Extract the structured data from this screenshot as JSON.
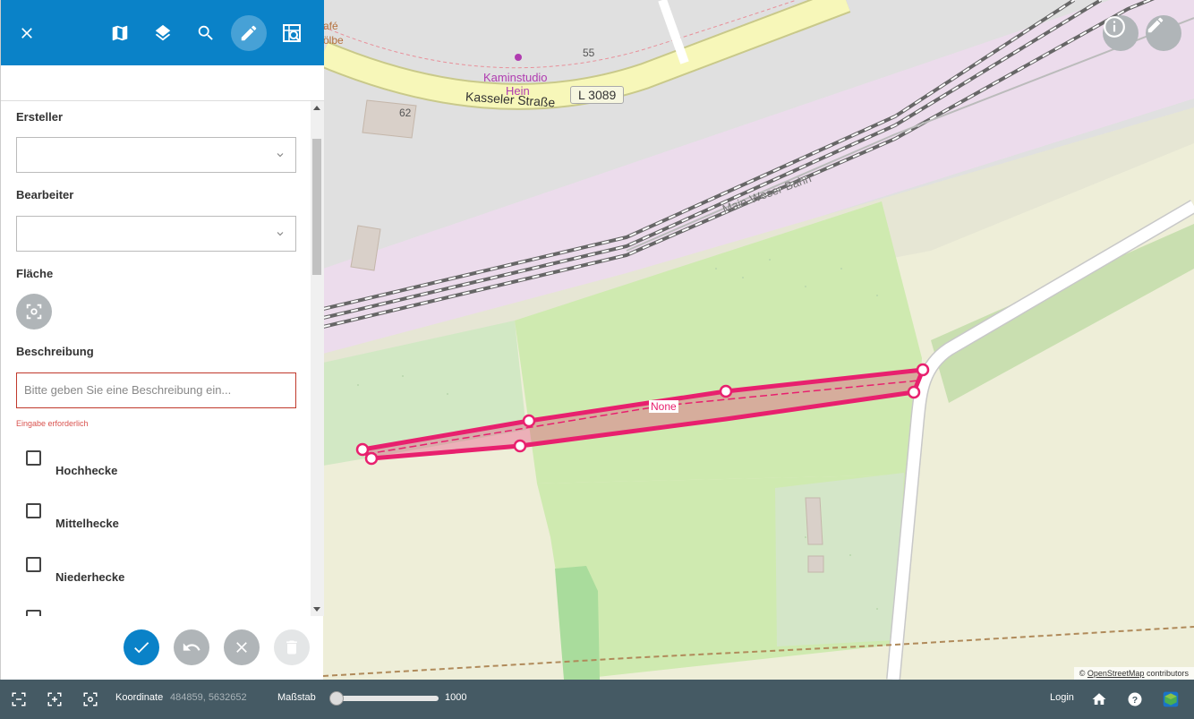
{
  "toolbar": {
    "buttons": [
      "close-icon",
      "map-icon",
      "layers-icon",
      "search-icon",
      "edit-icon",
      "map-search-icon"
    ],
    "accent": "#0a82c8"
  },
  "form": {
    "ersteller_label": "Ersteller",
    "ersteller_value": "",
    "bearbeiter_label": "Bearbeiter",
    "bearbeiter_value": "",
    "flaeche_label": "Fläche",
    "beschreibung_label": "Beschreibung",
    "beschreibung_placeholder": "Bitte geben Sie eine Beschreibung ein...",
    "beschreibung_error": "Eingabe erforderlich",
    "checkboxes": [
      {
        "label": "Hochhecke",
        "checked": false
      },
      {
        "label": "Mittelhecke",
        "checked": false
      },
      {
        "label": "Niederhecke",
        "checked": false
      }
    ]
  },
  "actions": [
    "check-icon",
    "undo-icon",
    "cancel-icon",
    "delete-icon"
  ],
  "map": {
    "labels": {
      "cafe": "afé",
      "cafe2": "ölbe",
      "house55": "55",
      "kaminstudio1": "Kaminstudio",
      "kaminstudio2": "Hein",
      "street": "Kasseler Straße",
      "road_ref": "L 3089",
      "house62": "62",
      "railway": "Main-Weser-Bahn",
      "feature_label": "None"
    },
    "attribution_prefix": "©",
    "attribution_link": "OpenStreetMap",
    "attribution_suffix": "contributors",
    "feature_color": "#e8206e"
  },
  "bottombar": {
    "coord_label": "Koordinate",
    "coord_value": "484859, 5632652",
    "scale_label": "Maßstab",
    "scale_value": "1000",
    "login": "Login"
  }
}
